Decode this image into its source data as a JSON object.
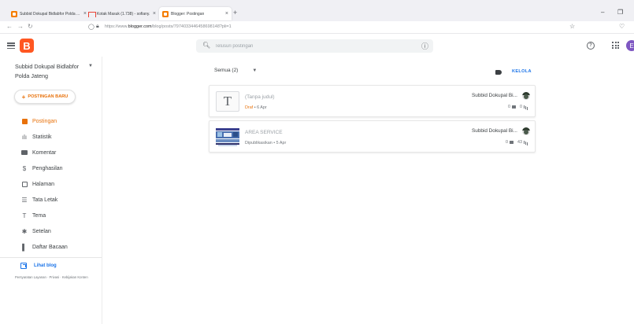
{
  "browser": {
    "tabs": [
      {
        "title": "Subbid Dokupal Bidlabfor Polda ...",
        "icon": "blogger-icon"
      },
      {
        "title": "Kotak Masuk (1.738) - sofiany.fl...",
        "icon": "gmail-icon"
      },
      {
        "title": "Blogger: Postingan",
        "icon": "blogger-icon"
      }
    ],
    "new_tab_label": "+",
    "url_prefix": "https://www.",
    "url_domain": "blogger.com",
    "url_path": "/blog/posts/7974033446458698148?pli=1"
  },
  "header": {
    "logo_letter": "B",
    "search_placeholder": "Telusuri postingan",
    "avatar_letter": "E"
  },
  "sidebar": {
    "blog_name": "Subbid Dokupal Bidlabfor Polda Jateng",
    "new_post_label": "POSTINGAN BARU",
    "items": [
      {
        "label": "Postingan",
        "icon": "posts-icon",
        "active": true
      },
      {
        "label": "Statistik",
        "icon": "stats-icon",
        "active": false
      },
      {
        "label": "Komentar",
        "icon": "comments-icon",
        "active": false
      },
      {
        "label": "Penghasilan",
        "icon": "earnings-icon",
        "active": false
      },
      {
        "label": "Halaman",
        "icon": "pages-icon",
        "active": false
      },
      {
        "label": "Tata Letak",
        "icon": "layout-icon",
        "active": false
      },
      {
        "label": "Tema",
        "icon": "theme-icon",
        "active": false
      },
      {
        "label": "Setelan",
        "icon": "settings-icon",
        "active": false
      },
      {
        "label": "Daftar Bacaan",
        "icon": "reading-list-icon",
        "active": false
      }
    ],
    "view_blog_label": "Lihat blog",
    "footer_links": "Persyaratan Layanan · Privasi · Kebijakan Konten"
  },
  "main": {
    "filter_label": "Semua (2)",
    "manage_label": "KELOLA",
    "posts": [
      {
        "title": "(Tanpa judul)",
        "thumb_letter": "T",
        "status": "Draf",
        "date": "6 Apr",
        "author": "Subbid Dokupal Bi...",
        "comments": "0",
        "views": "0"
      },
      {
        "title": "AREA SERVICE",
        "status": "Dipublikasikan",
        "date": "5 Apr",
        "author": "Subbid Dokupal Bi...",
        "comments": "0",
        "views": "43"
      }
    ]
  },
  "colors": {
    "accent_orange": "#e8710a",
    "blogger_logo": "#ff5722",
    "link_blue": "#1a73e8",
    "avatar_purple": "#7e57c2"
  }
}
